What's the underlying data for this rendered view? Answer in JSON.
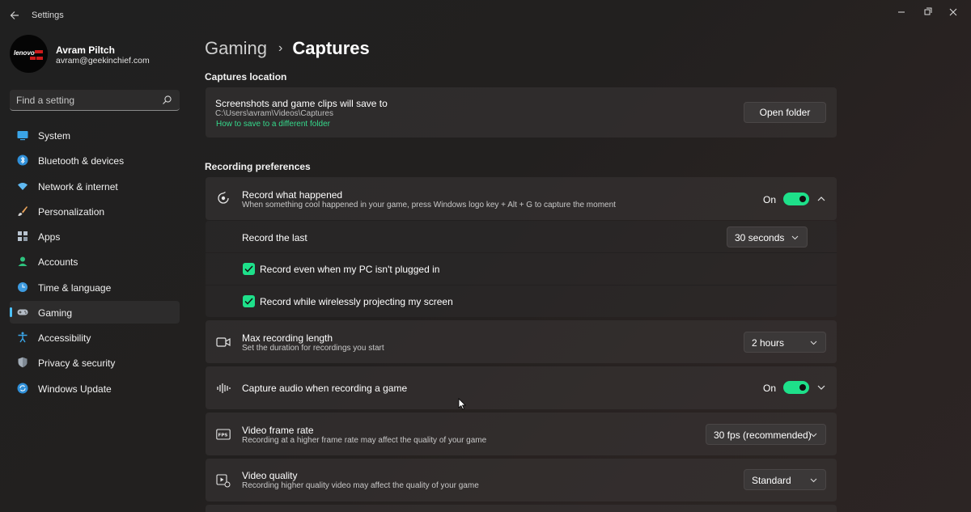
{
  "window": {
    "title": "Settings",
    "controls": [
      "minimize",
      "maximize",
      "close"
    ]
  },
  "profile": {
    "name": "Avram Piltch",
    "email": "avram@geekinchief.com",
    "avatar_text": "lenovo"
  },
  "search": {
    "placeholder": "Find a setting"
  },
  "sidebar": {
    "items": [
      {
        "label": "System",
        "icon": "monitor-icon",
        "active": false
      },
      {
        "label": "Bluetooth & devices",
        "icon": "bluetooth-icon",
        "active": false
      },
      {
        "label": "Network & internet",
        "icon": "wifi-icon",
        "active": false
      },
      {
        "label": "Personalization",
        "icon": "brush-icon",
        "active": false
      },
      {
        "label": "Apps",
        "icon": "apps-icon",
        "active": false
      },
      {
        "label": "Accounts",
        "icon": "person-icon",
        "active": false
      },
      {
        "label": "Time & language",
        "icon": "globe-clock-icon",
        "active": false
      },
      {
        "label": "Gaming",
        "icon": "gamepad-icon",
        "active": true
      },
      {
        "label": "Accessibility",
        "icon": "accessibility-icon",
        "active": false
      },
      {
        "label": "Privacy & security",
        "icon": "shield-icon",
        "active": false
      },
      {
        "label": "Windows Update",
        "icon": "update-icon",
        "active": false
      }
    ]
  },
  "breadcrumb": {
    "parent": "Gaming",
    "separator": "›",
    "current": "Captures"
  },
  "captures_location": {
    "heading": "Captures location",
    "title": "Screenshots and game clips will save to",
    "path": "C:\\Users\\avram\\Videos\\Captures",
    "link": "How to save to a different folder",
    "button": "Open folder"
  },
  "recording": {
    "heading": "Recording preferences",
    "record_what_happened": {
      "title": "Record what happened",
      "desc": "When something cool happened in your game, press Windows logo key + Alt + G to capture the moment",
      "state": "On",
      "expanded": true
    },
    "record_the_last": {
      "label": "Record the last",
      "value": "30 seconds"
    },
    "check_plugged": {
      "label": "Record even when my PC isn't plugged in",
      "checked": true
    },
    "check_projecting": {
      "label": "Record while wirelessly projecting my screen",
      "checked": true
    },
    "max_length": {
      "title": "Max recording length",
      "desc": "Set the duration for recordings you start",
      "value": "2 hours"
    },
    "capture_audio": {
      "title": "Capture audio when recording a game",
      "state": "On",
      "expanded": false
    },
    "frame_rate": {
      "title": "Video frame rate",
      "desc": "Recording at a higher frame rate may affect the quality of your game",
      "value": "30 fps (recommended)"
    },
    "quality": {
      "title": "Video quality",
      "desc": "Recording higher quality video may affect the quality of your game",
      "value": "Standard"
    }
  },
  "colors": {
    "accent": "#1ee08a",
    "nav_indicator": "#4cc2ff",
    "link": "#35d98c"
  }
}
